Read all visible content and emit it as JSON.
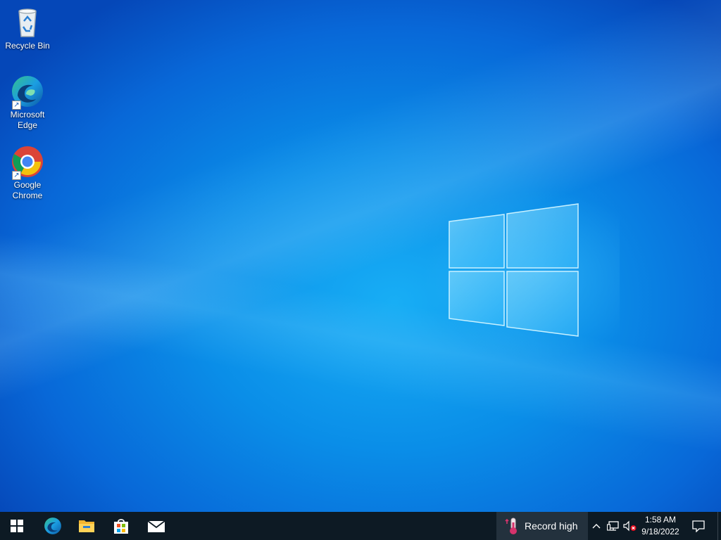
{
  "desktop": {
    "icons": [
      {
        "label": "Recycle Bin",
        "icon": "recycle-bin-icon"
      },
      {
        "label": "Microsoft Edge",
        "icon": "edge-icon"
      },
      {
        "label": "Google Chrome",
        "icon": "chrome-icon"
      }
    ]
  },
  "taskbar": {
    "start": {
      "icon": "windows-start-icon"
    },
    "pinned": [
      {
        "name": "Microsoft Edge",
        "icon": "edge-icon"
      },
      {
        "name": "File Explorer",
        "icon": "folder-icon"
      },
      {
        "name": "Microsoft Store",
        "icon": "store-icon"
      },
      {
        "name": "Mail",
        "icon": "mail-icon"
      }
    ],
    "weather": {
      "label": "Record high",
      "icon": "thermometer-icon"
    },
    "tray": {
      "icons": [
        "chevron-up-icon",
        "network-icon",
        "volume-muted-icon"
      ],
      "time": "1:58 AM",
      "date": "9/18/2022",
      "notification_icon": "action-center-icon"
    }
  },
  "colors": {
    "taskbar_bg": "#0d1a24",
    "wallpaper_accent": "#0a8ee8"
  }
}
